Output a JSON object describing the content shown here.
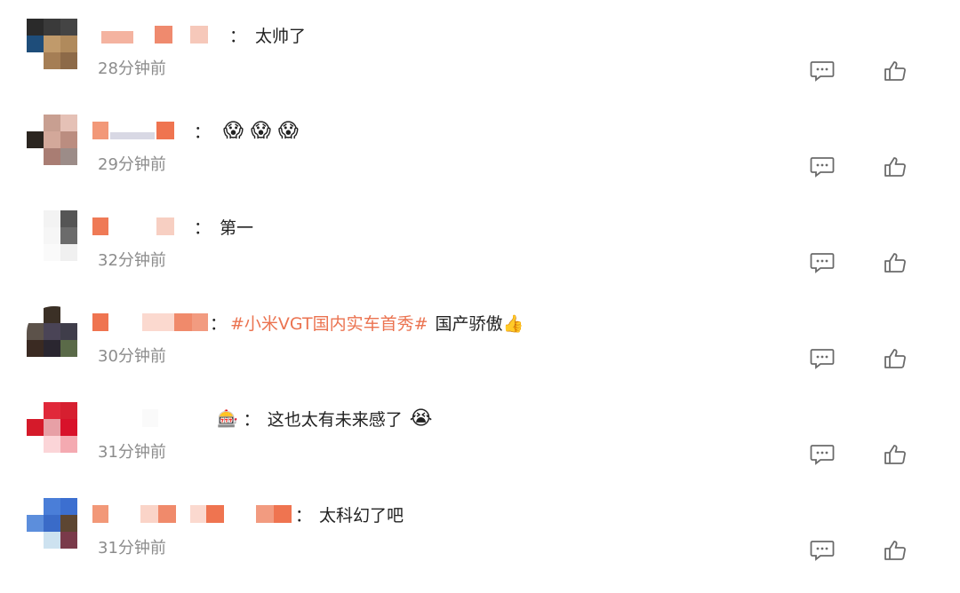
{
  "colors": {
    "accent": "#eb7350",
    "time": "#8c8c8c",
    "icon": "#6b6b6b"
  },
  "comments": [
    {
      "text": "太帅了",
      "time": "28分钟前"
    },
    {
      "emojis": "😱😱😱",
      "time": "29分钟前"
    },
    {
      "text": "第一",
      "time": "32分钟前"
    },
    {
      "topic": "#小米VGT国内实车首秀#",
      "text": "国产骄傲👍",
      "time": "30分钟前"
    },
    {
      "lead_emoji": "🎰",
      "text": "这也太有未来感了",
      "trail_emoji": "😭",
      "time": "31分钟前"
    },
    {
      "text": "太科幻了吧",
      "time": "31分钟前"
    }
  ],
  "actions": {
    "comment_icon": "comment-icon",
    "like_icon": "thumbs-up-icon"
  }
}
